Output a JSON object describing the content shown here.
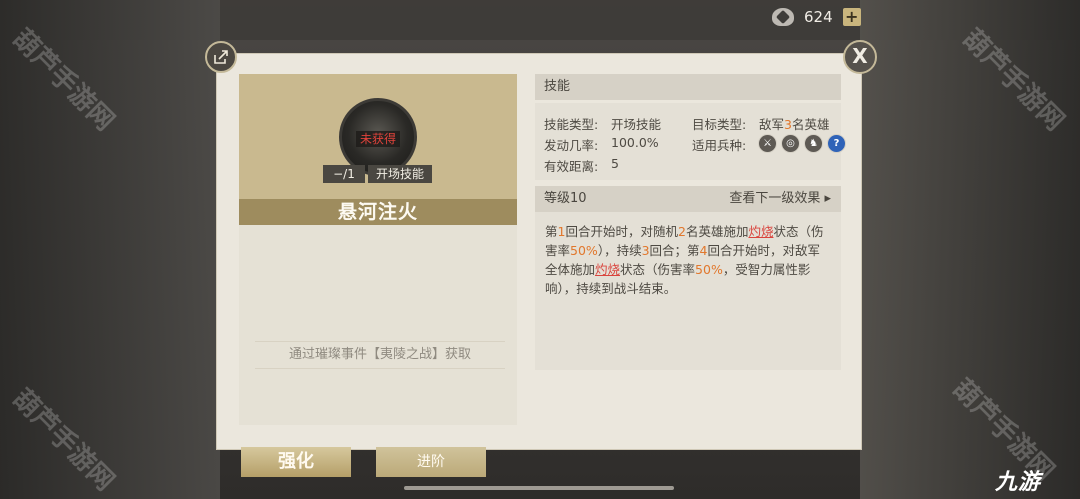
{
  "currency": {
    "icon": "crest-coin-icon",
    "value": "624",
    "add_label": "+"
  },
  "dialog": {
    "close_label": "X",
    "skill": {
      "name": "悬河注火",
      "status": "未获得",
      "count": "−/1",
      "type_tag": "开场技能",
      "acquire": "通过璀璨事件【夷陵之战】获取"
    },
    "info": {
      "section_title": "技能",
      "type_label": "技能类型:",
      "type_value": "开场技能",
      "target_label": "目标类型:",
      "target_prefix": "敌军",
      "target_num": "3",
      "target_suffix": "名英雄",
      "rate_label": "发动几率:",
      "rate_value": "100.0%",
      "units_label": "适用兵种:",
      "range_label": "有效距离:",
      "range_value": "5",
      "unit_icons": [
        "sword-icon",
        "target-icon",
        "horse-icon",
        "question-icon"
      ]
    },
    "level": {
      "label": "等级10",
      "next_label": "查看下一级效果 ▸"
    },
    "description": {
      "p1": "第",
      "n1": "1",
      "p2": "回合开始时，对随机",
      "n2": "2",
      "p3": "名英雄施加",
      "burn1": "灼烧",
      "p4": "状态（伤害率",
      "pct1": "50%",
      "p5": "），持续",
      "n3": "3",
      "p6": "回合；第",
      "n4": "4",
      "p7": "回合开始时，对敌军全体施加",
      "burn2": "灼烧",
      "p8": "状态（伤害率",
      "pct2": "50%",
      "p9": "，受智力属性影响），持续到战斗结束。"
    }
  },
  "buttons": {
    "strengthen": "强化",
    "advance": "进阶"
  },
  "brand": {
    "logo": "九游",
    "watermark": "葫芦手游网"
  }
}
